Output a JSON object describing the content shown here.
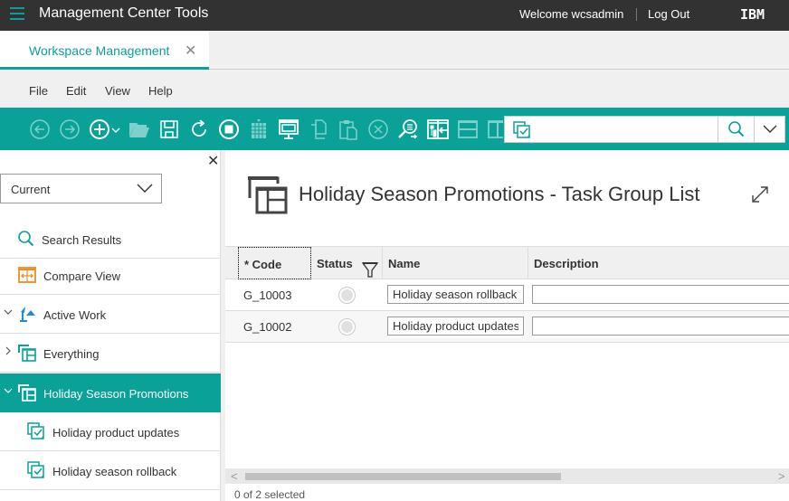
{
  "header": {
    "app_title": "Management Center Tools",
    "welcome": "Welcome wcsadmin",
    "logout": "Log Out",
    "logo": "IBM",
    "accent_color": "#0aa198"
  },
  "tabs": [
    {
      "label": "Workspace Management",
      "active": true,
      "close": "✕"
    }
  ],
  "menu": [
    "File",
    "Edit",
    "View",
    "Help"
  ],
  "toolbar": {
    "icons": [
      "back-icon",
      "forward-icon",
      "new-icon",
      "open-icon",
      "save-icon",
      "refresh-icon",
      "stop-icon",
      "grid-icon",
      "monitor-icon",
      "copy-icon",
      "paste-icon",
      "delete-icon",
      "find-references-icon",
      "move-icon",
      "split-horizontal-icon",
      "split-vertical-icon"
    ],
    "search": {
      "value": "",
      "placeholder": ""
    }
  },
  "sidebar": {
    "close": "✕",
    "select_value": "Current",
    "items": [
      {
        "label": "Search Results",
        "icon": "search-icon",
        "expander": ""
      },
      {
        "label": "Compare View",
        "icon": "compare-icon",
        "expander": ""
      },
      {
        "label": "Active Work",
        "icon": "lamp-icon",
        "expander": "expanded"
      },
      {
        "label": "Everything",
        "icon": "task-group-icon",
        "expander": "collapsed"
      },
      {
        "label": "Holiday Season Promotions",
        "icon": "task-group-icon",
        "expander": "expanded",
        "selected": true
      },
      {
        "label": "Holiday product updates",
        "icon": "task-icon",
        "expander": ""
      },
      {
        "label": "Holiday season rollback",
        "icon": "task-icon",
        "expander": ""
      }
    ]
  },
  "main": {
    "title": "Holiday Season Promotions - Task Group List",
    "columns": [
      "* Code",
      "Status",
      "Name",
      "Description"
    ],
    "rows": [
      {
        "code": "G_10003",
        "status": "inactive",
        "name": "Holiday season rollback",
        "description": ""
      },
      {
        "code": "G_10002",
        "status": "inactive",
        "name": "Holiday product updates",
        "description": ""
      }
    ],
    "selection_status": "0 of 2 selected"
  }
}
